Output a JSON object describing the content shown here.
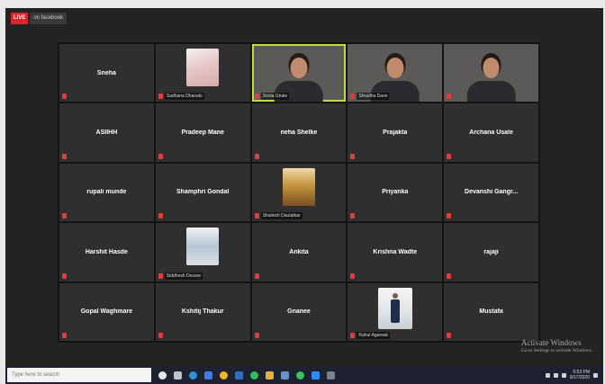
{
  "meeting": {
    "live_badge": "LIVE",
    "top_label": "on facebook"
  },
  "tiles": [
    {
      "name": "Sneha",
      "kind": "name"
    },
    {
      "name": "Sadhana Dhanaki",
      "kind": "photo",
      "pic": "pic-1"
    },
    {
      "name": "Sonia Ghale",
      "kind": "video",
      "bg": "video-bg-1",
      "active": true
    },
    {
      "name": "Shradha Dave",
      "kind": "video",
      "bg": "video-bg-2"
    },
    {
      "name": "",
      "kind": "video",
      "bg": "video-bg-3"
    },
    {
      "name": "ASIIHH",
      "kind": "name"
    },
    {
      "name": "Pradeep Mane",
      "kind": "name"
    },
    {
      "name": "neha Shelke",
      "kind": "name"
    },
    {
      "name": "Prajakta",
      "kind": "name"
    },
    {
      "name": "Archana Usale",
      "kind": "name"
    },
    {
      "name": "rupali munde",
      "kind": "name"
    },
    {
      "name": "Shamphri Gondal",
      "kind": "name"
    },
    {
      "name": "Shailesh Daulatkar",
      "kind": "photo",
      "pic": "pic-2"
    },
    {
      "name": "Priyanka",
      "kind": "name"
    },
    {
      "name": "Devanshi Gangr...",
      "kind": "name"
    },
    {
      "name": "Harshit Hasde",
      "kind": "name"
    },
    {
      "name": "Siddhesh Desare",
      "kind": "photo",
      "pic": "pic-3"
    },
    {
      "name": "Ankita",
      "kind": "name"
    },
    {
      "name": "Krishna Wadte",
      "kind": "name"
    },
    {
      "name": "rajaji",
      "kind": "name"
    },
    {
      "name": "Gopal Waghmare",
      "kind": "name"
    },
    {
      "name": "Kshitij Thakur",
      "kind": "name"
    },
    {
      "name": "Gnanee",
      "kind": "name"
    },
    {
      "name": "Rahul Agarwal",
      "kind": "figure"
    },
    {
      "name": "Mustafa",
      "kind": "name"
    }
  ],
  "watermark": {
    "title": "Activate Windows",
    "subtitle": "Go to Settings to activate Windows."
  },
  "taskbar": {
    "search_placeholder": "Type here to search",
    "icons": [
      {
        "name": "cortana-icon",
        "color": "#e8e8e8",
        "round": true
      },
      {
        "name": "task-view-icon",
        "color": "#bfc4cc"
      },
      {
        "name": "edge-icon",
        "color": "#2f8fd8",
        "round": true
      },
      {
        "name": "store-icon",
        "color": "#3f7be0"
      },
      {
        "name": "chrome-icon",
        "color": "#f0b32a",
        "round": true
      },
      {
        "name": "mail-icon",
        "color": "#2a6fc4"
      },
      {
        "name": "spotify-icon",
        "color": "#2fbf5a",
        "round": true
      },
      {
        "name": "explorer-icon",
        "color": "#e3b13e"
      },
      {
        "name": "photos-icon",
        "color": "#6a8fc8"
      },
      {
        "name": "whatsapp-icon",
        "color": "#38c25c",
        "round": true
      },
      {
        "name": "zoom-icon",
        "color": "#2d8cff"
      },
      {
        "name": "settings-icon",
        "color": "#7b8190"
      }
    ],
    "time": "9:53 PM",
    "date": "9/17/2020"
  }
}
